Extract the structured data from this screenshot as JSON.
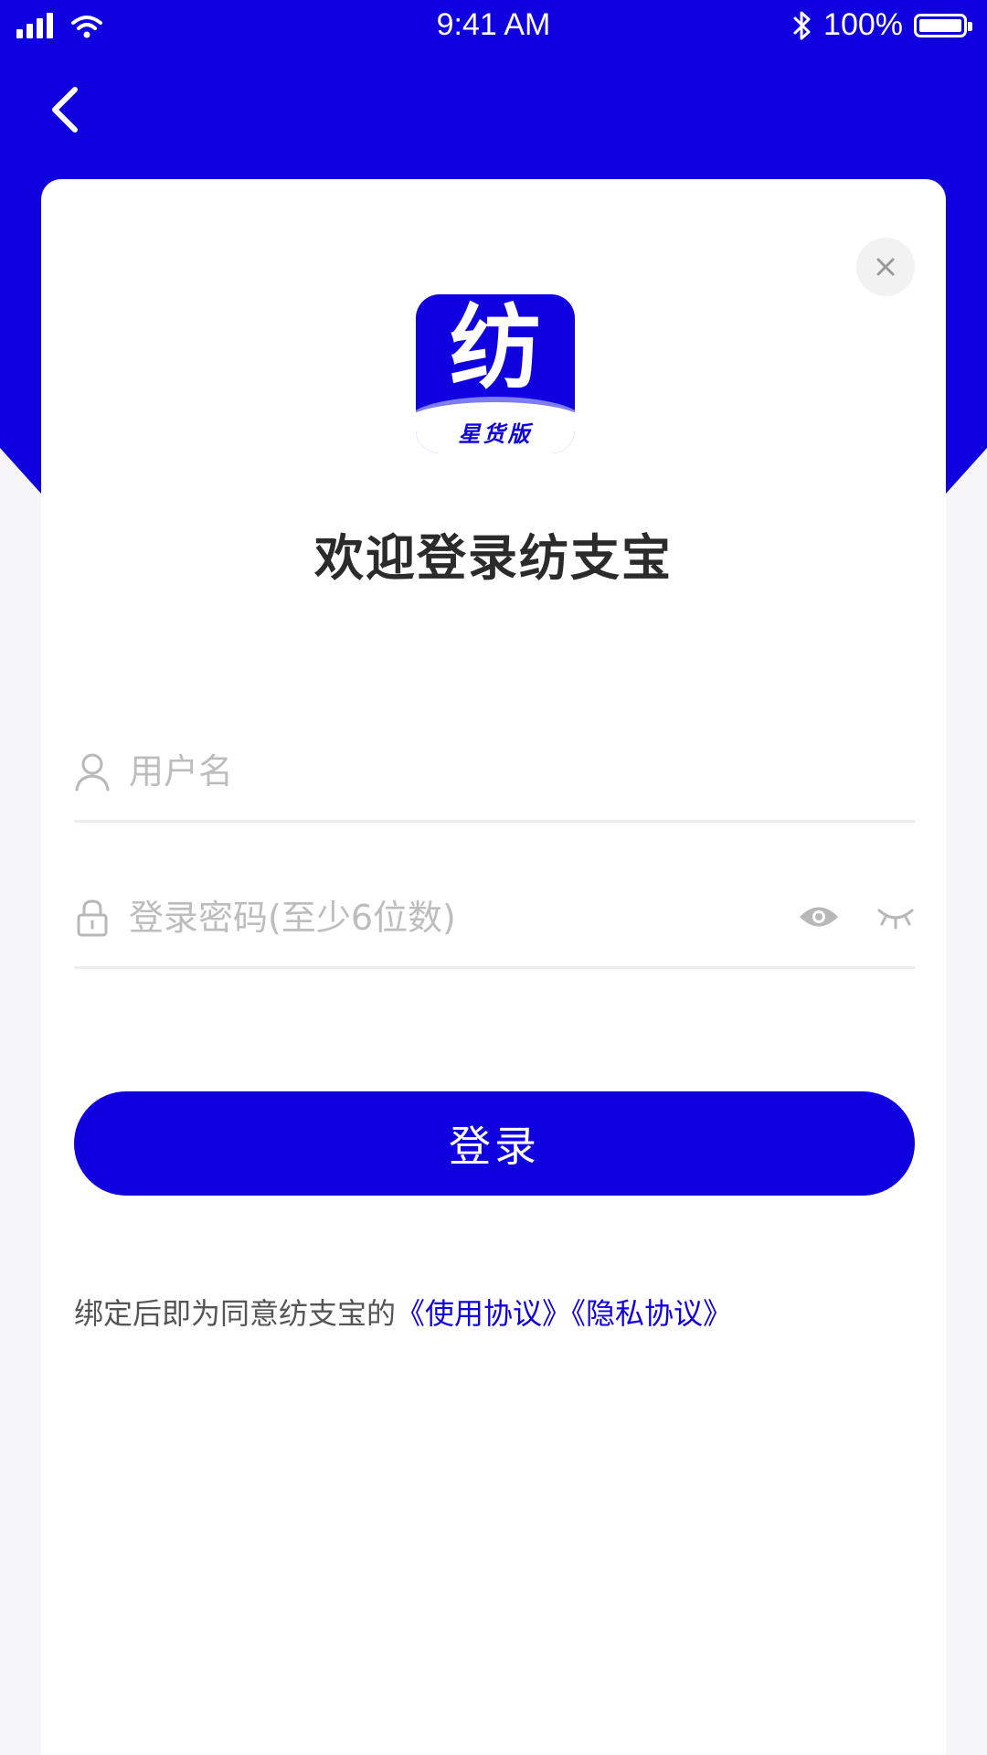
{
  "status_bar": {
    "time": "9:41 AM",
    "battery": "100%"
  },
  "logo": {
    "char": "纺",
    "sub": "星货版"
  },
  "welcome_title": "欢迎登录纺支宝",
  "form": {
    "username_placeholder": "用户名",
    "password_placeholder": "登录密码(至少6位数)",
    "login_label": "登录"
  },
  "agreement": {
    "prefix": "绑定后即为同意纺支宝的",
    "terms": "《使用协议》",
    "privacy": "《隐私协议》"
  },
  "colors": {
    "brand": "#1000e0"
  }
}
